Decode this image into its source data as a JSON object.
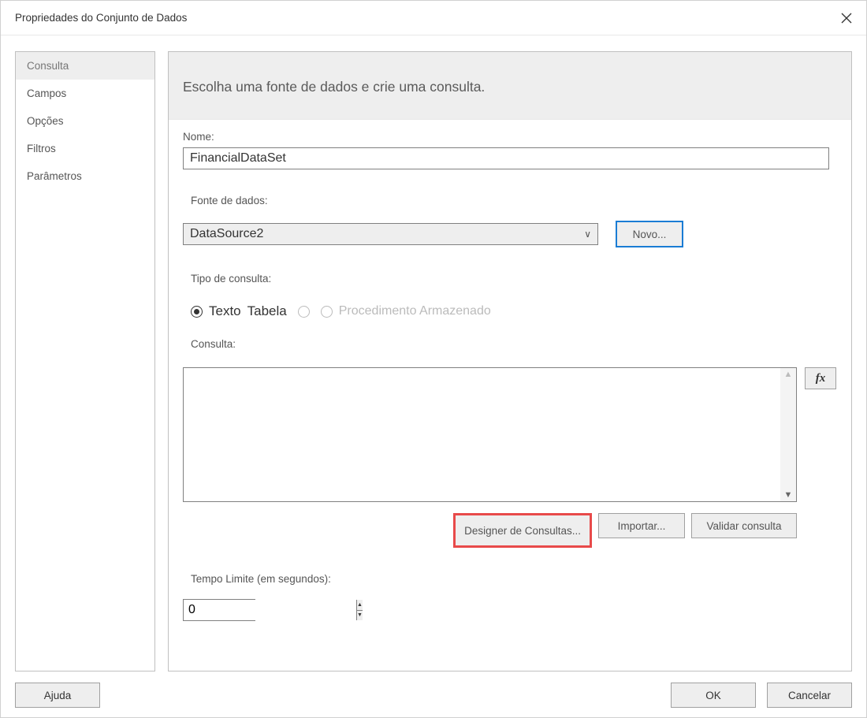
{
  "window": {
    "title": "Propriedades do Conjunto de Dados"
  },
  "sidebar": {
    "items": [
      {
        "label": "Consulta",
        "active": true
      },
      {
        "label": "Campos",
        "active": false
      },
      {
        "label": "Opções",
        "active": false
      },
      {
        "label": "Filtros",
        "active": false
      },
      {
        "label": "Parâmetros",
        "active": false
      }
    ]
  },
  "main": {
    "header": "Escolha uma fonte de dados e crie uma consulta.",
    "name_label": "Nome:",
    "name_value": "FinancialDataSet",
    "datasource_label": "Fonte de dados:",
    "datasource_selected": "DataSource2",
    "new_button": "Novo...",
    "querytype_label": "Tipo de consulta:",
    "radios": {
      "text": "Texto",
      "table": "Tabela",
      "sproc": "Procedimento Armazenado"
    },
    "query_label": "Consulta:",
    "query_value": "",
    "fx_label": "fx",
    "actions": {
      "designer": "Designer de Consultas...",
      "import": "Importar...",
      "validate": "Validar consulta"
    },
    "timeout_label": "Tempo Limite (em segundos):",
    "timeout_value": "0"
  },
  "footer": {
    "help": "Ajuda",
    "ok": "OK",
    "cancel": "Cancelar"
  }
}
